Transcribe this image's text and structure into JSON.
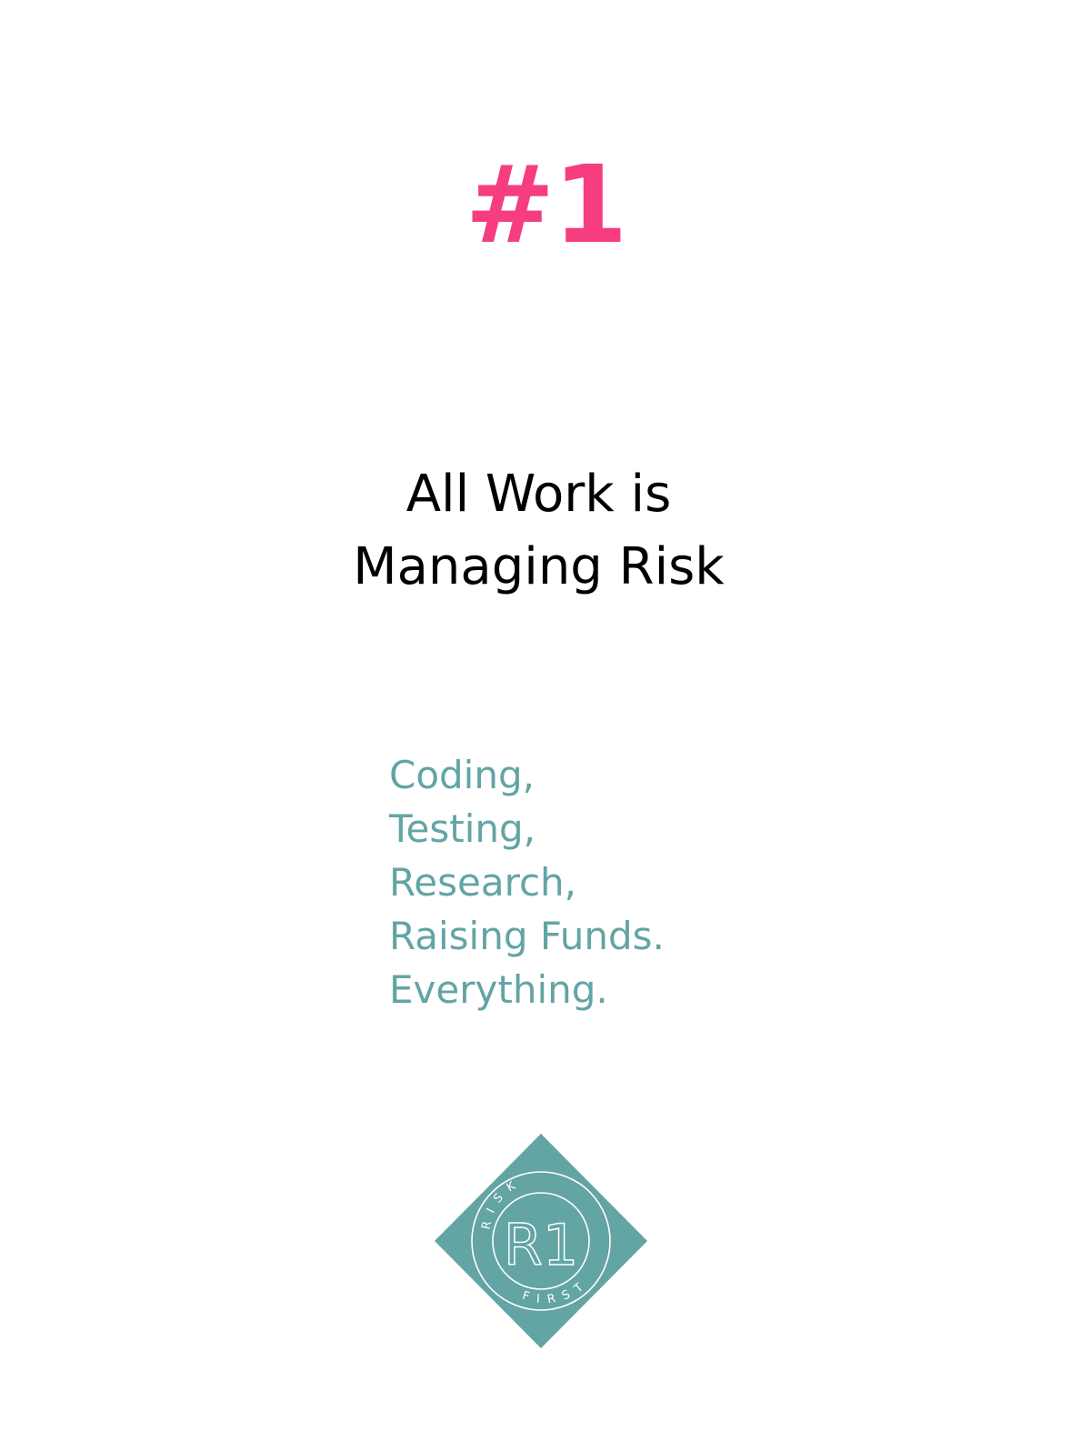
{
  "colors": {
    "accent": "#f63d80",
    "teal": "#63a4a4",
    "text": "#000000",
    "background": "#ffffff"
  },
  "card": {
    "number": "#1",
    "headline_line1": "All Work is",
    "headline_line2": "Managing Risk",
    "items": [
      "Coding,",
      "Testing,",
      "Research,",
      "Raising Funds.",
      "Everything."
    ]
  },
  "logo": {
    "icon": "risk-first-logo-icon",
    "top_text": "RISK",
    "bottom_text": "FIRST",
    "monogram": "R1"
  }
}
